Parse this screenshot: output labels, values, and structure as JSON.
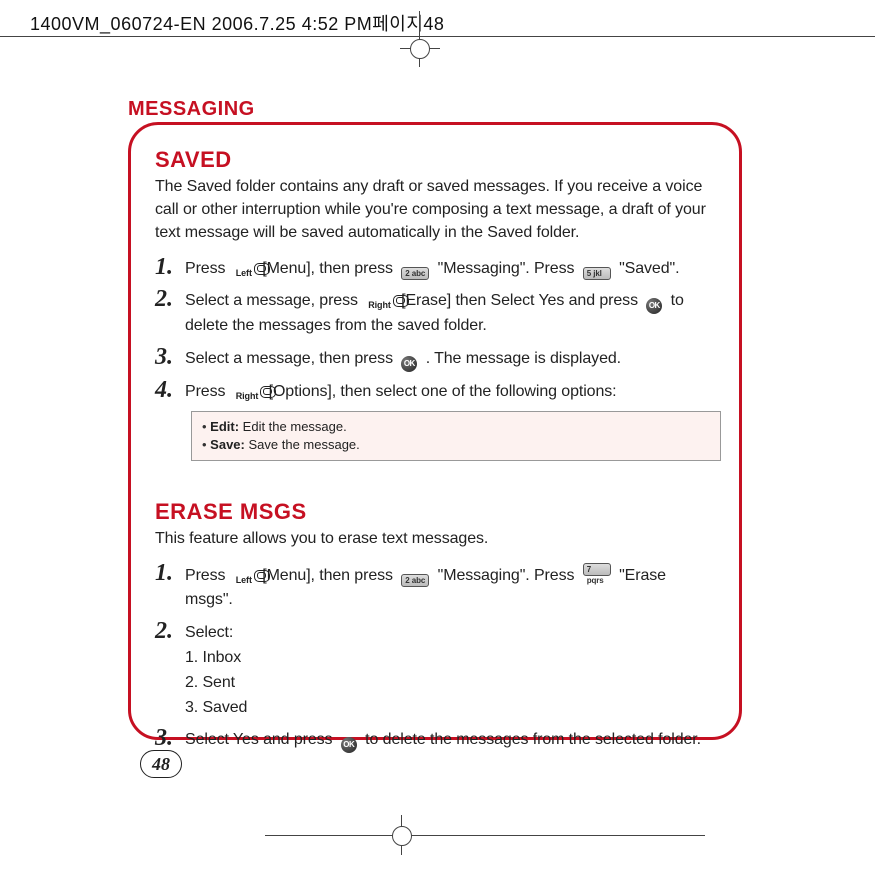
{
  "header": {
    "text": "1400VM_060724-EN  2006.7.25 4:52 PM페이지48"
  },
  "section_title": "MESSAGING",
  "page_number": "48",
  "saved": {
    "heading": "SAVED",
    "intro": "The Saved folder contains any draft or saved messages.  If you receive a voice call or other interruption while you're composing a text message, a draft of your text message will be saved automatically in the Saved folder.",
    "steps": [
      {
        "num": "1.",
        "parts": {
          "a": "Press ",
          "b": " [Menu], then press ",
          "c": " \"Messaging\".  Press ",
          "d": " \"Saved\"."
        }
      },
      {
        "num": "2.",
        "parts": {
          "a": "Select a message, press ",
          "b": " [Erase] then Select Yes and press ",
          "c": " to delete the messages from the saved folder."
        }
      },
      {
        "num": "3.",
        "parts": {
          "a": "Select a message, then press ",
          "b": " .  The message is displayed."
        }
      },
      {
        "num": "4.",
        "parts": {
          "a": "Press ",
          "b": " [Options], then select one of the following options:"
        }
      }
    ],
    "keys": {
      "left": "Left",
      "right": "Right",
      "k2": "2 abc",
      "k5": "5 jkl",
      "ok": "OK"
    },
    "options": [
      {
        "label": "Edit:",
        "desc": " Edit the message."
      },
      {
        "label": "Save:",
        "desc": " Save the message."
      }
    ]
  },
  "erase": {
    "heading": "ERASE MSGS",
    "intro": "This feature allows you to erase text messages.",
    "steps": [
      {
        "num": "1.",
        "parts": {
          "a": "Press ",
          "b": " [Menu], then press ",
          "c": " \"Messaging\".  Press ",
          "d": " \"Erase msgs\"."
        }
      },
      {
        "num": "2.",
        "parts": {
          "a": "Select:"
        }
      },
      {
        "num": "3.",
        "parts": {
          "a": "Select Yes and press ",
          "b": " to delete the messages from the selected folder."
        }
      }
    ],
    "select_options": [
      "1. Inbox",
      "2. Sent",
      "3. Saved"
    ],
    "keys": {
      "left": "Left",
      "k2": "2 abc",
      "k7": "7 pqrs",
      "ok": "OK"
    }
  }
}
